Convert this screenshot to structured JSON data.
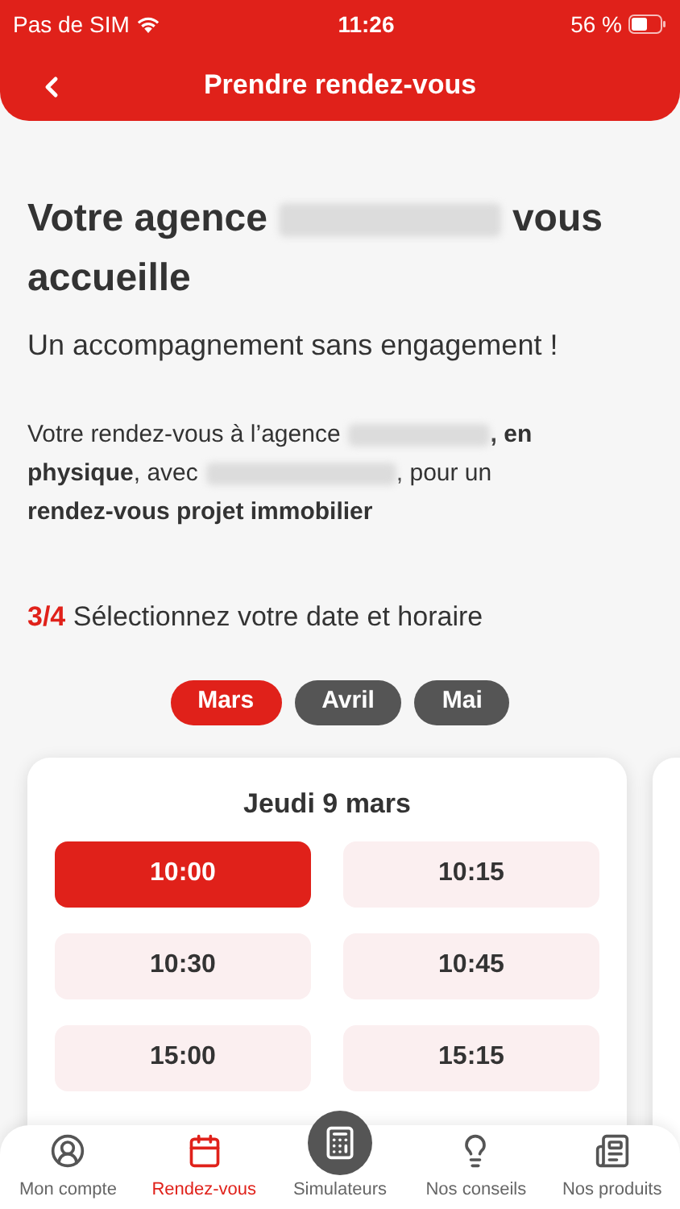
{
  "status_bar": {
    "carrier": "Pas de SIM",
    "time": "11:26",
    "battery": "56 %"
  },
  "header": {
    "title": "Prendre rendez-vous"
  },
  "heading": [
    {
      "kind": "text",
      "text": "Votre agence"
    },
    {
      "kind": "redacted"
    },
    {
      "kind": "text",
      "text": "vous accueille"
    }
  ],
  "subtitle": "Un accompagnement sans engagement !",
  "summary": [
    {
      "kind": "text",
      "text": "Votre rendez-vous à l’agence"
    },
    {
      "kind": "redacted"
    },
    {
      "kind": "text",
      "text": "**, en physique**, avec"
    },
    {
      "kind": "redacted"
    },
    {
      "kind": "text",
      "text": ", pour un **rendez-vous projet immobilier**"
    }
  ],
  "step": {
    "number": "3/4",
    "label": "Sélectionnez votre date et horaire"
  },
  "months": [
    {
      "label": "Mars",
      "selected": true
    },
    {
      "label": "Avril",
      "selected": false
    },
    {
      "label": "Mai",
      "selected": false
    }
  ],
  "day": {
    "title": "Jeudi 9 mars",
    "slots": [
      {
        "time": "10:00",
        "selected": true
      },
      {
        "time": "10:15",
        "selected": false
      },
      {
        "time": "10:30",
        "selected": false
      },
      {
        "time": "10:45",
        "selected": false
      },
      {
        "time": "15:00",
        "selected": false
      },
      {
        "time": "15:15",
        "selected": false
      }
    ]
  },
  "nav": [
    {
      "label": "Mon compte",
      "kind": "tab",
      "selected": false
    },
    {
      "label": "Rendez-vous",
      "kind": "tab",
      "selected": true
    },
    {
      "label": "Simulateurs",
      "kind": "raised",
      "selected": false
    },
    {
      "label": "Nos conseils",
      "kind": "tab",
      "selected": false
    },
    {
      "label": "Nos produits",
      "kind": "tab",
      "selected": false
    }
  ]
}
